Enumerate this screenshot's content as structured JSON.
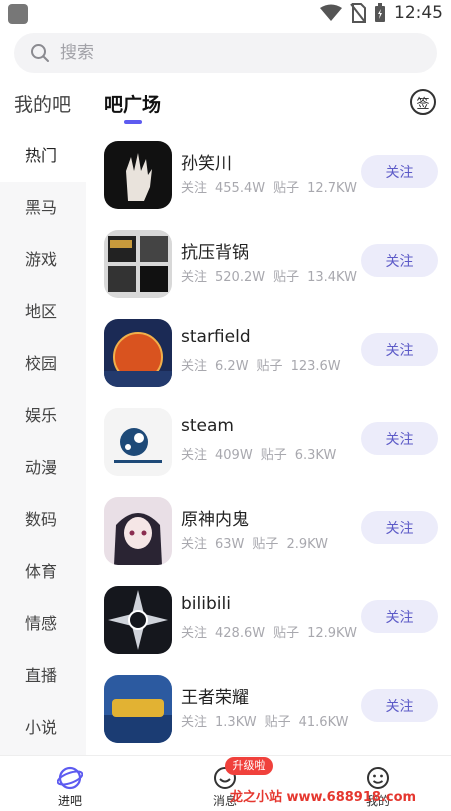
{
  "status_bar": {
    "time": "12:45"
  },
  "search": {
    "placeholder": "搜索"
  },
  "tabs": {
    "my_bars": "我的吧",
    "square": "吧广场",
    "sign": "签"
  },
  "categories": [
    "热门",
    "黑马",
    "游戏",
    "地区",
    "校园",
    "娱乐",
    "动漫",
    "数码",
    "体育",
    "情感",
    "直播",
    "小说"
  ],
  "active_category": "热门",
  "stat_labels": {
    "follow": "关注",
    "posts": "贴子"
  },
  "items": [
    {
      "name": "孙笑川",
      "followers": "455.4W",
      "posts": "12.7KW",
      "button": "关注"
    },
    {
      "name": "抗压背锅",
      "followers": "520.2W",
      "posts": "13.4KW",
      "button": "关注"
    },
    {
      "name": "starfield",
      "followers": "6.2W",
      "posts": "123.6W",
      "button": "关注"
    },
    {
      "name": "steam",
      "followers": "409W",
      "posts": "6.3KW",
      "button": "关注"
    },
    {
      "name": "原神内鬼",
      "followers": "63W",
      "posts": "2.9KW",
      "button": "关注"
    },
    {
      "name": "bilibili",
      "followers": "428.6W",
      "posts": "12.9KW",
      "button": "关注"
    },
    {
      "name": "王者荣耀",
      "followers": "1.3KW",
      "posts": "41.6KW",
      "button": "关注"
    }
  ],
  "bottom_nav": {
    "enter": "进吧",
    "messages": "消息",
    "mine": "我的",
    "badge": "升级啦"
  },
  "watermark": "龙之小站 www.688918.com",
  "colors": {
    "accent": "#5d5bf0",
    "follow_bg": "#ececfa",
    "follow_text": "#5c5ac7",
    "badge": "#f0413c"
  }
}
